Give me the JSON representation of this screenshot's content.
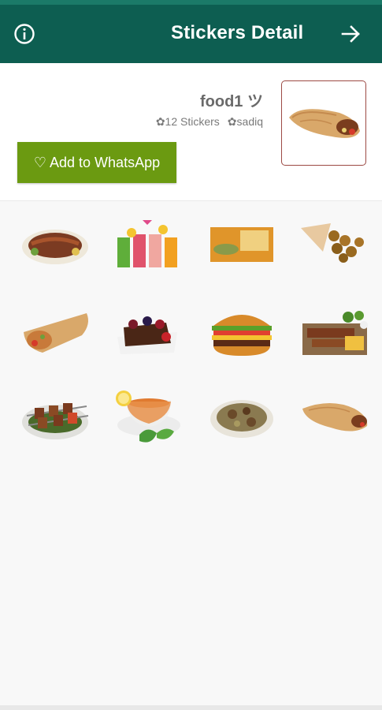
{
  "appbar": {
    "title": "Stickers Detail",
    "left_icon": "info-icon",
    "right_icon": "arrow-right-icon"
  },
  "pack": {
    "name": "food1 ツ",
    "stickers_count": "✿12 Stickers",
    "author": "✿sadiq",
    "tray_icon": "shawarma-wrap"
  },
  "add_button": {
    "label": "♡ Add to WhatsApp"
  },
  "stickers": [
    "grilled-meat-platter",
    "fruit-juices",
    "knafeh-dessert",
    "falafel-cone",
    "shawarma-wrap",
    "chocolate-berry-cake",
    "hamburger",
    "kebab-fries-plate",
    "kebab-skewers-plate",
    "tea-cup-lemon",
    "meat-stew-bowl",
    "shawarma-roll"
  ],
  "colors": {
    "appbar": "#0d5e51",
    "statusbar": "#1b7a68",
    "button": "#6b9a11",
    "tray_border": "#9c4a44"
  }
}
